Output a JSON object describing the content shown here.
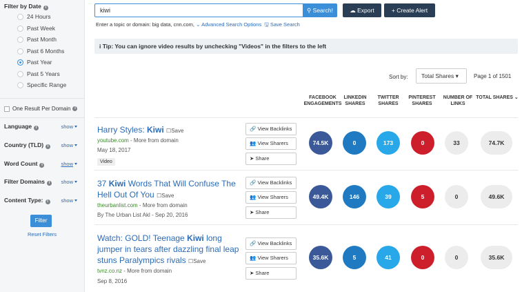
{
  "sidebar": {
    "filter_by_date": "Filter by Date",
    "date_options": [
      "24 Hours",
      "Past Week",
      "Past Month",
      "Past 6 Months",
      "Past Year",
      "Past 5 Years",
      "Specific Range"
    ],
    "selected_date": "Past Year",
    "one_result": "One Result Per Domain",
    "filters": [
      {
        "label": "Language",
        "show": "show"
      },
      {
        "label": "Country (TLD)",
        "show": "show"
      },
      {
        "label": "Word Count",
        "show": "show"
      },
      {
        "label": "Filter Domains",
        "show": "show"
      },
      {
        "label": "Content Type:",
        "show": "show"
      }
    ],
    "filter_button": "Filter",
    "reset_filters": "Reset Filters"
  },
  "search": {
    "value": "kiwi",
    "button": "Search!",
    "export": "Export",
    "create_alert": "Create Alert",
    "hint_text": "Enter a topic or domain: big data, cnn.com,",
    "advanced": "Advanced Search Options",
    "save_search": "Save Search"
  },
  "tip": "Tip: You can ignore video results by unchecking \"Videos\" in the filters to the left",
  "sort": {
    "label": "Sort by:",
    "value": "Total Shares",
    "page": "Page 1 of 1501"
  },
  "columns": {
    "facebook": [
      "FACEBOOK",
      "ENGAGEMENTS"
    ],
    "linkedin": [
      "LINKEDIN",
      "SHARES"
    ],
    "twitter": [
      "TWITTER",
      "SHARES"
    ],
    "pinterest": [
      "PINTEREST",
      "SHARES"
    ],
    "links": [
      "NUMBER OF",
      "LINKS"
    ],
    "total": "TOTAL SHARES"
  },
  "actions": {
    "backlinks": "View Backlinks",
    "sharers": "View Sharers",
    "share": "Share"
  },
  "results": [
    {
      "title_pre": "Harry Styles: ",
      "title_kw": "Kiwi",
      "title_post": "",
      "title_line2": "",
      "save": "Save",
      "domain": "youtube.com",
      "more": " - More from domain",
      "meta": "May 18, 2017",
      "tag": "Video",
      "facebook": "74.5K",
      "linkedin": "0",
      "twitter": "173",
      "pinterest": "0",
      "links": "33",
      "total": "74.7K"
    },
    {
      "title_pre": "37 ",
      "title_kw": "Kiwi",
      "title_post": " Words That Will Confuse The",
      "title_line2": "Hell Out Of You",
      "save": "Save",
      "domain": "theurbanlist.com",
      "more": " - More from domain",
      "meta": "By The Urban List Akl - Sep 20, 2016",
      "tag": "",
      "facebook": "49.4K",
      "linkedin": "146",
      "twitter": "39",
      "pinterest": "5",
      "links": "0",
      "total": "49.6K"
    },
    {
      "title_pre": "Watch: GOLD! Teenage ",
      "title_kw": "Kiwi",
      "title_post": " long",
      "title_line2": "jumper in tears after dazzling final leap",
      "title_line3": "stuns Paralympics rivals",
      "save": "Save",
      "domain": "tvnz.co.nz",
      "more": " - More from domain",
      "meta": "Sep 8, 2016",
      "tag": "",
      "facebook": "35.6K",
      "linkedin": "5",
      "twitter": "41",
      "pinterest": "0",
      "links": "0",
      "total": "35.6K"
    }
  ],
  "colors": {
    "accent": "#3a8fd8",
    "dark_button": "#2a3f55",
    "facebook": "#3b5998",
    "linkedin": "#1f7ac2",
    "twitter": "#28a8e8",
    "pinterest": "#cc1f2b"
  }
}
